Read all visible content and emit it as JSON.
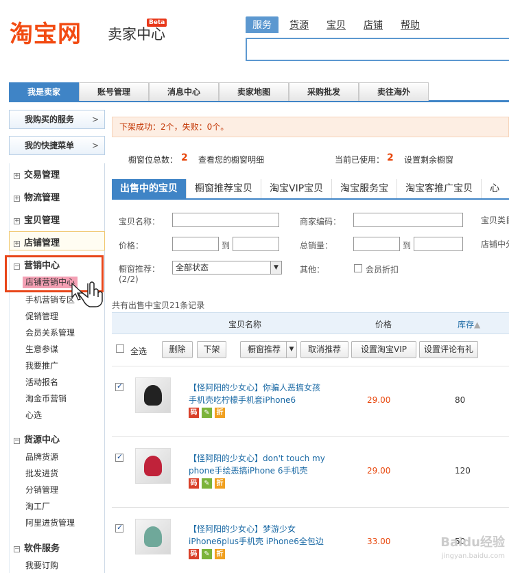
{
  "header": {
    "logo": "淘宝网",
    "sub": "卖家中心",
    "beta": "Beta",
    "search_tabs": [
      "服务",
      "货源",
      "宝贝",
      "店铺",
      "帮助"
    ]
  },
  "topnav": [
    "我是卖家",
    "账号管理",
    "消息中心",
    "卖家地图",
    "采购批发",
    "卖往海外"
  ],
  "sidebar": {
    "service": "我购买的服务",
    "shortcut": "我的快捷菜单",
    "arrow": ">",
    "groups": [
      {
        "label": "交易管理",
        "icon": "⊞"
      },
      {
        "label": "物流管理",
        "icon": "⊞"
      },
      {
        "label": "宝贝管理",
        "icon": "⊞"
      },
      {
        "label": "店铺管理",
        "icon": "⊞"
      },
      {
        "label": "营销中心",
        "icon": "⊟"
      },
      {
        "label": "货源中心",
        "icon": "⊟"
      },
      {
        "label": "软件服务",
        "icon": "⊟"
      }
    ],
    "marketing": [
      "店铺营销中心",
      "手机营销专区",
      "促销管理",
      "会员关系管理",
      "生意参谋",
      "我要推广",
      "活动报名",
      "淘金币营销",
      "心选"
    ],
    "supply": [
      "品牌货源",
      "批发进货",
      "分销管理",
      "淘工厂",
      "阿里进货管理"
    ],
    "software": [
      "我要订购"
    ]
  },
  "banner": "下架成功：2个，失败：0个。",
  "info": {
    "total_label": "橱窗位总数：",
    "total": "2",
    "detail_link": "查看您的橱窗明细",
    "used_label": "当前已使用：",
    "used": "2",
    "set_link": "设置剩余橱窗"
  },
  "tabs": [
    "出售中的宝贝",
    "橱窗推荐宝贝",
    "淘宝VIP宝贝",
    "淘宝服务宝",
    "淘宝客推广宝贝",
    "心"
  ],
  "filters": {
    "name": "宝贝名称：",
    "code": "商家编码：",
    "cat": "宝贝类目",
    "price": "价格：",
    "to": "到",
    "sales": "总销量：",
    "shop_cat": "店铺中分",
    "window": "橱窗推荐：",
    "window_count": "(2/2)",
    "window_value": "全部状态",
    "other": "其他：",
    "member": "会员折扣"
  },
  "count": "共有出售中宝贝21条记录",
  "table": {
    "col_name": "宝贝名称",
    "col_price": "价格",
    "col_stock": "库存"
  },
  "actions": {
    "select_all": "全选",
    "delete": "删除",
    "offshelf": "下架",
    "recommend": "橱窗推荐",
    "cancel": "取消推荐",
    "vip": "设置淘宝VIP",
    "gift": "设置评论有礼"
  },
  "products": [
    {
      "title": "【怪阿阳的少女心】你骗人恶搞女孩手机壳吃柠檬手机套iPhone6",
      "price": "29.00",
      "stock": "80",
      "checked": true
    },
    {
      "title": "【怪阿阳的少女心】don't touch my phone手绘恶搞iPhone 6手机壳",
      "price": "29.00",
      "stock": "120",
      "checked": true
    },
    {
      "title": "【怪阿阳的少女心】梦游少女iPhone6plus手机壳 iPhone6全包边",
      "price": "33.00",
      "stock": "50",
      "checked": true
    }
  ],
  "badges": [
    "码",
    "折"
  ],
  "colors": {
    "accent": "#3f84c6",
    "brand": "#f24b12",
    "highlight": "#e8461a"
  },
  "watermark": {
    "main": "Baidu经验",
    "sub": "jingyan.baidu.com"
  }
}
